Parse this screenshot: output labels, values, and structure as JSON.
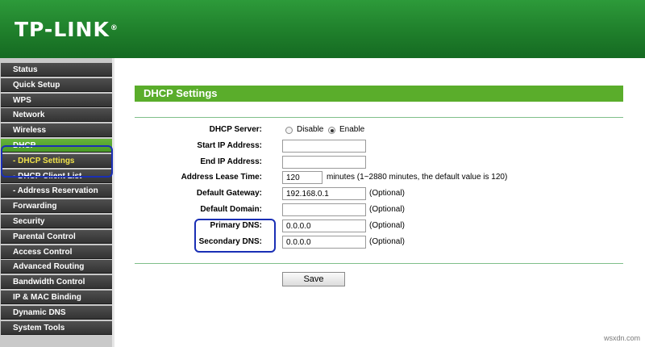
{
  "header": {
    "brand": "TP-LINK",
    "trademark": "®"
  },
  "sidebar": {
    "items": [
      {
        "label": "Status"
      },
      {
        "label": "Quick Setup"
      },
      {
        "label": "WPS"
      },
      {
        "label": "Network"
      },
      {
        "label": "Wireless"
      },
      {
        "label": "DHCP"
      },
      {
        "label": "- DHCP Settings"
      },
      {
        "label": "- DHCP Client List"
      },
      {
        "label": "- Address Reservation"
      },
      {
        "label": "Forwarding"
      },
      {
        "label": "Security"
      },
      {
        "label": "Parental Control"
      },
      {
        "label": "Access Control"
      },
      {
        "label": "Advanced Routing"
      },
      {
        "label": "Bandwidth Control"
      },
      {
        "label": "IP & MAC Binding"
      },
      {
        "label": "Dynamic DNS"
      },
      {
        "label": "System Tools"
      }
    ],
    "active_index": 5,
    "active_sub_index": 6
  },
  "main": {
    "title": "DHCP Settings",
    "dhcp_server": {
      "label": "DHCP Server:",
      "option_disable": "Disable",
      "option_enable": "Enable",
      "selected": "Enable"
    },
    "start_ip": {
      "label": "Start IP Address:",
      "value": ""
    },
    "end_ip": {
      "label": "End IP Address:",
      "value": ""
    },
    "lease_time": {
      "label": "Address Lease Time:",
      "value": "120",
      "note": "minutes (1~2880 minutes, the default value is 120)"
    },
    "gateway": {
      "label": "Default Gateway:",
      "value": "192.168.0.1",
      "note": "(Optional)"
    },
    "domain": {
      "label": "Default Domain:",
      "value": "",
      "note": "(Optional)"
    },
    "primary_dns": {
      "label": "Primary DNS:",
      "value": "0.0.0.0",
      "note": "(Optional)"
    },
    "secondary_dns": {
      "label": "Secondary DNS:",
      "value": "0.0.0.0",
      "note": "(Optional)"
    },
    "save_label": "Save"
  },
  "watermark": "wsxdn.com",
  "colors": {
    "header_green": "#1f7f2b",
    "accent_green": "#5aad2b",
    "highlight_blue": "#1a2fb5"
  }
}
